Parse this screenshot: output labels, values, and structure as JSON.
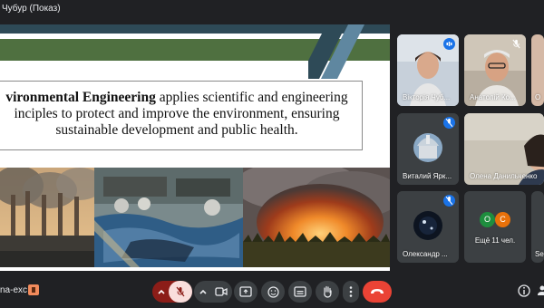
{
  "presenter": {
    "label": "Чубур (Показ)"
  },
  "slide": {
    "bold_text": "vironmental Engineering",
    "body_text": " applies scientific and engineering principles to protect and improve the environment, ensuring sustainable development and public health.",
    "line1_rest": " applies scientific and engineering",
    "line2": "inciples to protect and improve the environment, ensuring",
    "line3": "sustainable development and public health."
  },
  "participants": [
    {
      "name": "Вікторія Чуб...",
      "mic": "speaking"
    },
    {
      "name": "Анатолій Ко...",
      "mic": "muted"
    },
    {
      "name": "О",
      "mic": "none"
    },
    {
      "name": "Виталий Ярк...",
      "mic": "muted"
    },
    {
      "name": "Олена Данильченко",
      "mic": "none"
    },
    {
      "name": "Олександр ...",
      "mic": "muted"
    },
    {
      "name": "Ещё 11 чел.",
      "initials": [
        "O",
        "C"
      ],
      "mic": "none"
    },
    {
      "name": "Se",
      "mic": "none"
    }
  ],
  "bottom": {
    "meeting_code_fragment": "na-exc",
    "controls": [
      "expand",
      "mic-off",
      "more-options",
      "camera",
      "present",
      "emoji",
      "captions",
      "raise-hand",
      "more",
      "leave"
    ]
  },
  "colors": {
    "accent_blue": "#1a73e8",
    "leave_red": "#ea4335",
    "background": "#202124",
    "tile": "#3c4043"
  }
}
